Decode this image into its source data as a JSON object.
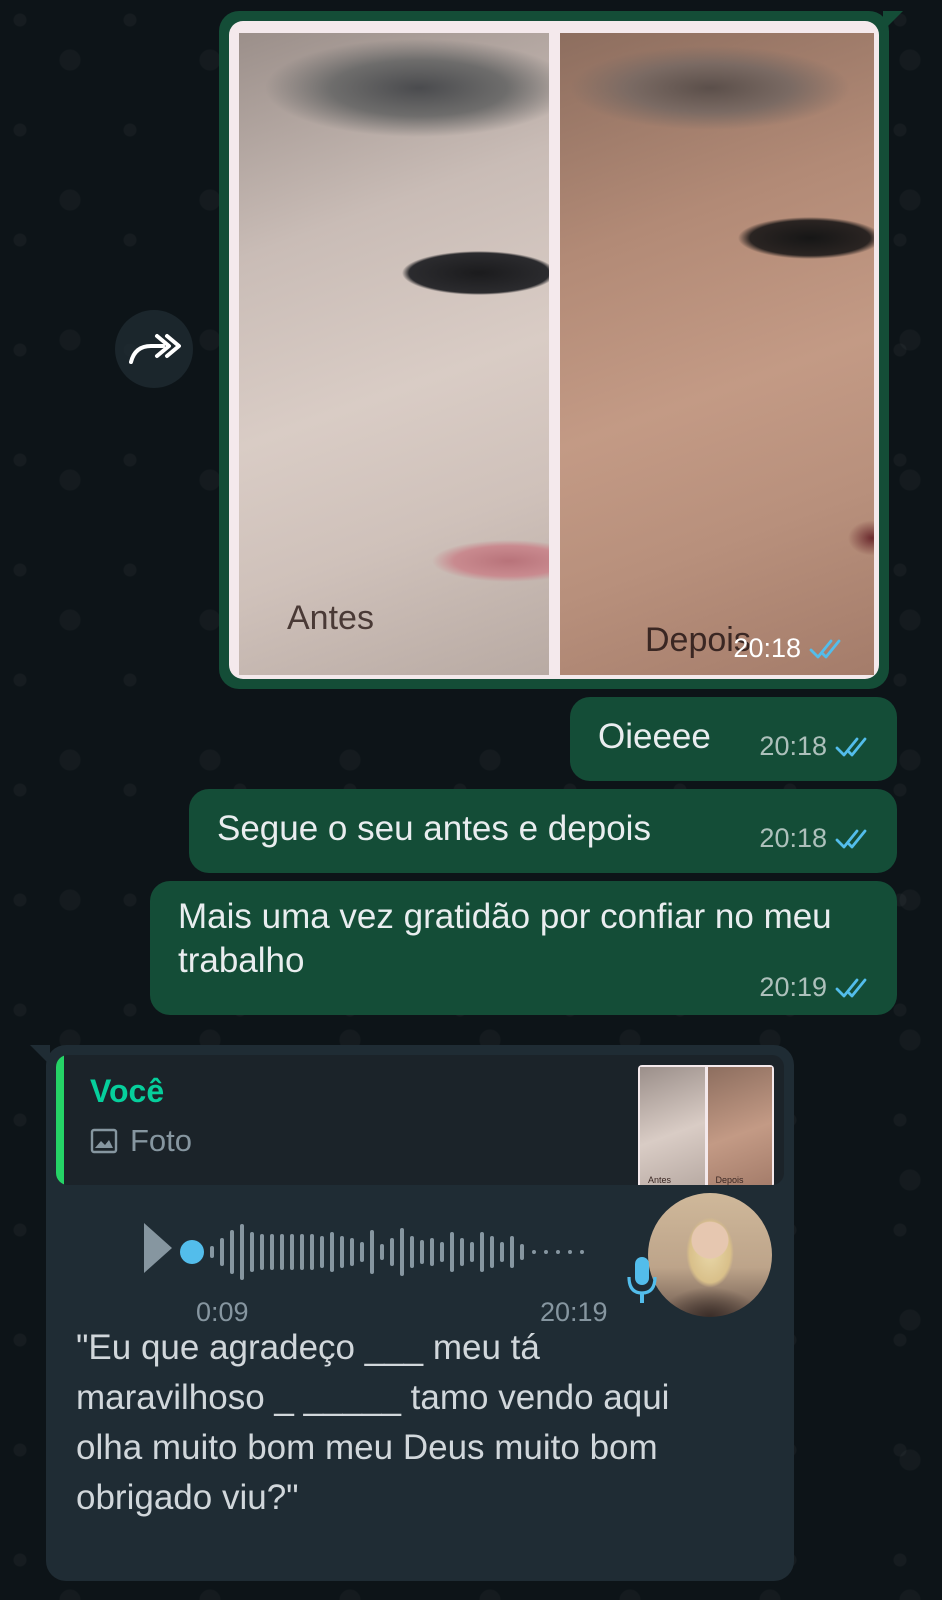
{
  "messages": {
    "image_message": {
      "left_label": "Antes",
      "right_label": "Depois",
      "time": "20:18"
    },
    "msg1": {
      "text": "Oieeee",
      "time": "20:18"
    },
    "msg2": {
      "text": "Segue o seu antes e depois",
      "time": "20:18"
    },
    "msg3": {
      "text": "Mais uma vez gratidão por confiar no meu trabalho",
      "time": "20:19"
    }
  },
  "incoming": {
    "quote": {
      "author": "Você",
      "type_label": "Foto",
      "thumb_left": "Antes",
      "thumb_right": "Depois"
    },
    "voice": {
      "duration": "0:09",
      "time": "20:19",
      "progress": 0
    },
    "transcript": "\"Eu que agradeço ___ meu tá maravilhoso _ _____ tamo vendo aqui olha muito bom meu Deus muito bom obrigado viu?\""
  },
  "icons": {
    "forward": "forward-arrow-icon",
    "read_receipt": "double-check-icon",
    "photo": "image-icon",
    "play": "play-icon",
    "mic": "microphone-icon"
  },
  "colors": {
    "outgoing_bubble": "#144d37",
    "incoming_bubble": "#1f2c34",
    "read_tick": "#53bdeb",
    "quote_accent": "#25d366",
    "author": "#06cf9c"
  }
}
